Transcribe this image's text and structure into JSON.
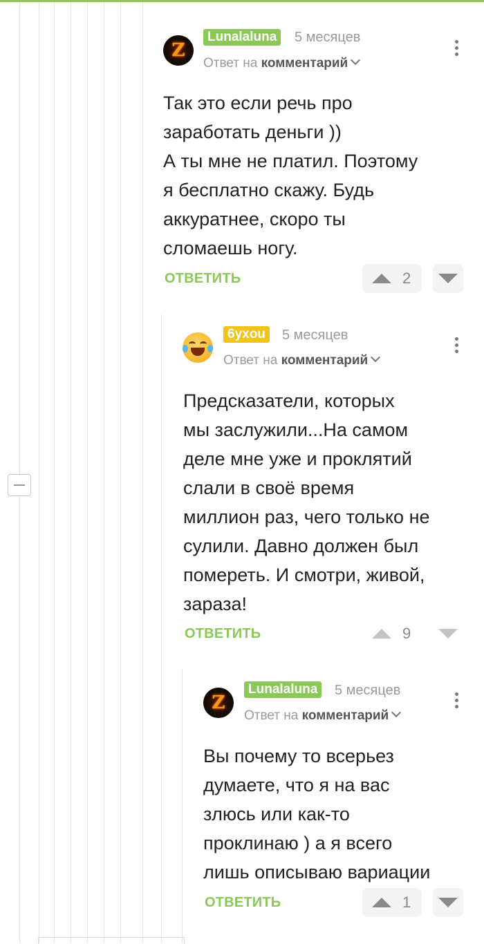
{
  "comments": [
    {
      "username": "Lunalaluna",
      "user_color": "#8ac858",
      "time": "5 месяцев",
      "reply_prefix": "Ответ на",
      "reply_target": "комментарий",
      "text": "Так это если речь про\nзаработать деньги ))\nА ты мне не платил. Поэтому\nя бесплатно скажу. Будь\nаккуратнее, скоро ты\nсломаешь ногу.",
      "reply_label": "ОТВЕТИТЬ",
      "votes": "2"
    },
    {
      "username": "6yxou",
      "user_color": "#f2c318",
      "time": "5 месяцев",
      "reply_prefix": "Ответ на",
      "reply_target": "комментарий",
      "text": "Предсказатели, которых\nмы заслужили...На самом\nделе мне уже и проклятий\nслали в своё время\nмиллион раз, чего только не\nсулили. Давно должен был\nпомереть. И смотри, живой,\nзараза!",
      "reply_label": "ОТВЕТИТЬ",
      "votes": "9"
    },
    {
      "username": "Lunalaluna",
      "user_color": "#8ac858",
      "time": "5 месяцев",
      "reply_prefix": "Ответ на",
      "reply_target": "комментарий",
      "text": "Вы почему то всерьез\nдумаете, что я на вас\nзлюсь или как-то\nпроклинаю ) а я всего\nлишь описываю вариации",
      "reply_label": "ОТВЕТИТЬ",
      "votes": "1"
    }
  ],
  "icons": {
    "avatar_1": "flaming-z-avatar",
    "avatar_2": "laughing-emoji-avatar",
    "more": "kebab-menu-icon",
    "collapse": "collapse-thread-icon",
    "upvote": "triangle-up-icon",
    "downvote": "triangle-down-icon",
    "chevron": "chevron-down-icon"
  },
  "colors": {
    "accent": "#8ac858",
    "username_yellow": "#f2c318"
  }
}
